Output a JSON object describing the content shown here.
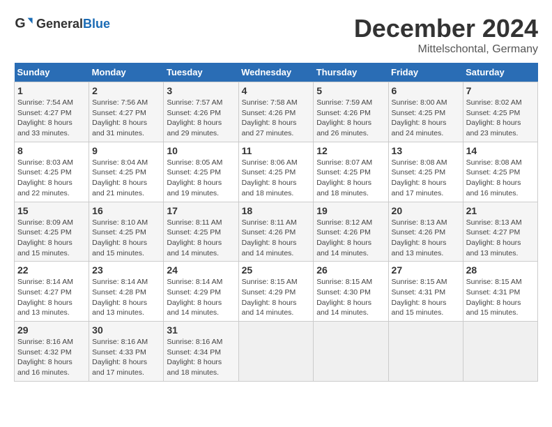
{
  "header": {
    "logo_general": "General",
    "logo_blue": "Blue",
    "month_title": "December 2024",
    "location": "Mittelschontal, Germany"
  },
  "days_of_week": [
    "Sunday",
    "Monday",
    "Tuesday",
    "Wednesday",
    "Thursday",
    "Friday",
    "Saturday"
  ],
  "weeks": [
    [
      {
        "day": "1",
        "sunrise": "7:54 AM",
        "sunset": "4:27 PM",
        "daylight": "8 hours and 33 minutes."
      },
      {
        "day": "2",
        "sunrise": "7:56 AM",
        "sunset": "4:27 PM",
        "daylight": "8 hours and 31 minutes."
      },
      {
        "day": "3",
        "sunrise": "7:57 AM",
        "sunset": "4:26 PM",
        "daylight": "8 hours and 29 minutes."
      },
      {
        "day": "4",
        "sunrise": "7:58 AM",
        "sunset": "4:26 PM",
        "daylight": "8 hours and 27 minutes."
      },
      {
        "day": "5",
        "sunrise": "7:59 AM",
        "sunset": "4:26 PM",
        "daylight": "8 hours and 26 minutes."
      },
      {
        "day": "6",
        "sunrise": "8:00 AM",
        "sunset": "4:25 PM",
        "daylight": "8 hours and 24 minutes."
      },
      {
        "day": "7",
        "sunrise": "8:02 AM",
        "sunset": "4:25 PM",
        "daylight": "8 hours and 23 minutes."
      }
    ],
    [
      {
        "day": "8",
        "sunrise": "8:03 AM",
        "sunset": "4:25 PM",
        "daylight": "8 hours and 22 minutes."
      },
      {
        "day": "9",
        "sunrise": "8:04 AM",
        "sunset": "4:25 PM",
        "daylight": "8 hours and 21 minutes."
      },
      {
        "day": "10",
        "sunrise": "8:05 AM",
        "sunset": "4:25 PM",
        "daylight": "8 hours and 19 minutes."
      },
      {
        "day": "11",
        "sunrise": "8:06 AM",
        "sunset": "4:25 PM",
        "daylight": "8 hours and 18 minutes."
      },
      {
        "day": "12",
        "sunrise": "8:07 AM",
        "sunset": "4:25 PM",
        "daylight": "8 hours and 18 minutes."
      },
      {
        "day": "13",
        "sunrise": "8:08 AM",
        "sunset": "4:25 PM",
        "daylight": "8 hours and 17 minutes."
      },
      {
        "day": "14",
        "sunrise": "8:08 AM",
        "sunset": "4:25 PM",
        "daylight": "8 hours and 16 minutes."
      }
    ],
    [
      {
        "day": "15",
        "sunrise": "8:09 AM",
        "sunset": "4:25 PM",
        "daylight": "8 hours and 15 minutes."
      },
      {
        "day": "16",
        "sunrise": "8:10 AM",
        "sunset": "4:25 PM",
        "daylight": "8 hours and 15 minutes."
      },
      {
        "day": "17",
        "sunrise": "8:11 AM",
        "sunset": "4:25 PM",
        "daylight": "8 hours and 14 minutes."
      },
      {
        "day": "18",
        "sunrise": "8:11 AM",
        "sunset": "4:26 PM",
        "daylight": "8 hours and 14 minutes."
      },
      {
        "day": "19",
        "sunrise": "8:12 AM",
        "sunset": "4:26 PM",
        "daylight": "8 hours and 14 minutes."
      },
      {
        "day": "20",
        "sunrise": "8:13 AM",
        "sunset": "4:26 PM",
        "daylight": "8 hours and 13 minutes."
      },
      {
        "day": "21",
        "sunrise": "8:13 AM",
        "sunset": "4:27 PM",
        "daylight": "8 hours and 13 minutes."
      }
    ],
    [
      {
        "day": "22",
        "sunrise": "8:14 AM",
        "sunset": "4:27 PM",
        "daylight": "8 hours and 13 minutes."
      },
      {
        "day": "23",
        "sunrise": "8:14 AM",
        "sunset": "4:28 PM",
        "daylight": "8 hours and 13 minutes."
      },
      {
        "day": "24",
        "sunrise": "8:14 AM",
        "sunset": "4:29 PM",
        "daylight": "8 hours and 14 minutes."
      },
      {
        "day": "25",
        "sunrise": "8:15 AM",
        "sunset": "4:29 PM",
        "daylight": "8 hours and 14 minutes."
      },
      {
        "day": "26",
        "sunrise": "8:15 AM",
        "sunset": "4:30 PM",
        "daylight": "8 hours and 14 minutes."
      },
      {
        "day": "27",
        "sunrise": "8:15 AM",
        "sunset": "4:31 PM",
        "daylight": "8 hours and 15 minutes."
      },
      {
        "day": "28",
        "sunrise": "8:15 AM",
        "sunset": "4:31 PM",
        "daylight": "8 hours and 15 minutes."
      }
    ],
    [
      {
        "day": "29",
        "sunrise": "8:16 AM",
        "sunset": "4:32 PM",
        "daylight": "8 hours and 16 minutes."
      },
      {
        "day": "30",
        "sunrise": "8:16 AM",
        "sunset": "4:33 PM",
        "daylight": "8 hours and 17 minutes."
      },
      {
        "day": "31",
        "sunrise": "8:16 AM",
        "sunset": "4:34 PM",
        "daylight": "8 hours and 18 minutes."
      },
      null,
      null,
      null,
      null
    ]
  ]
}
